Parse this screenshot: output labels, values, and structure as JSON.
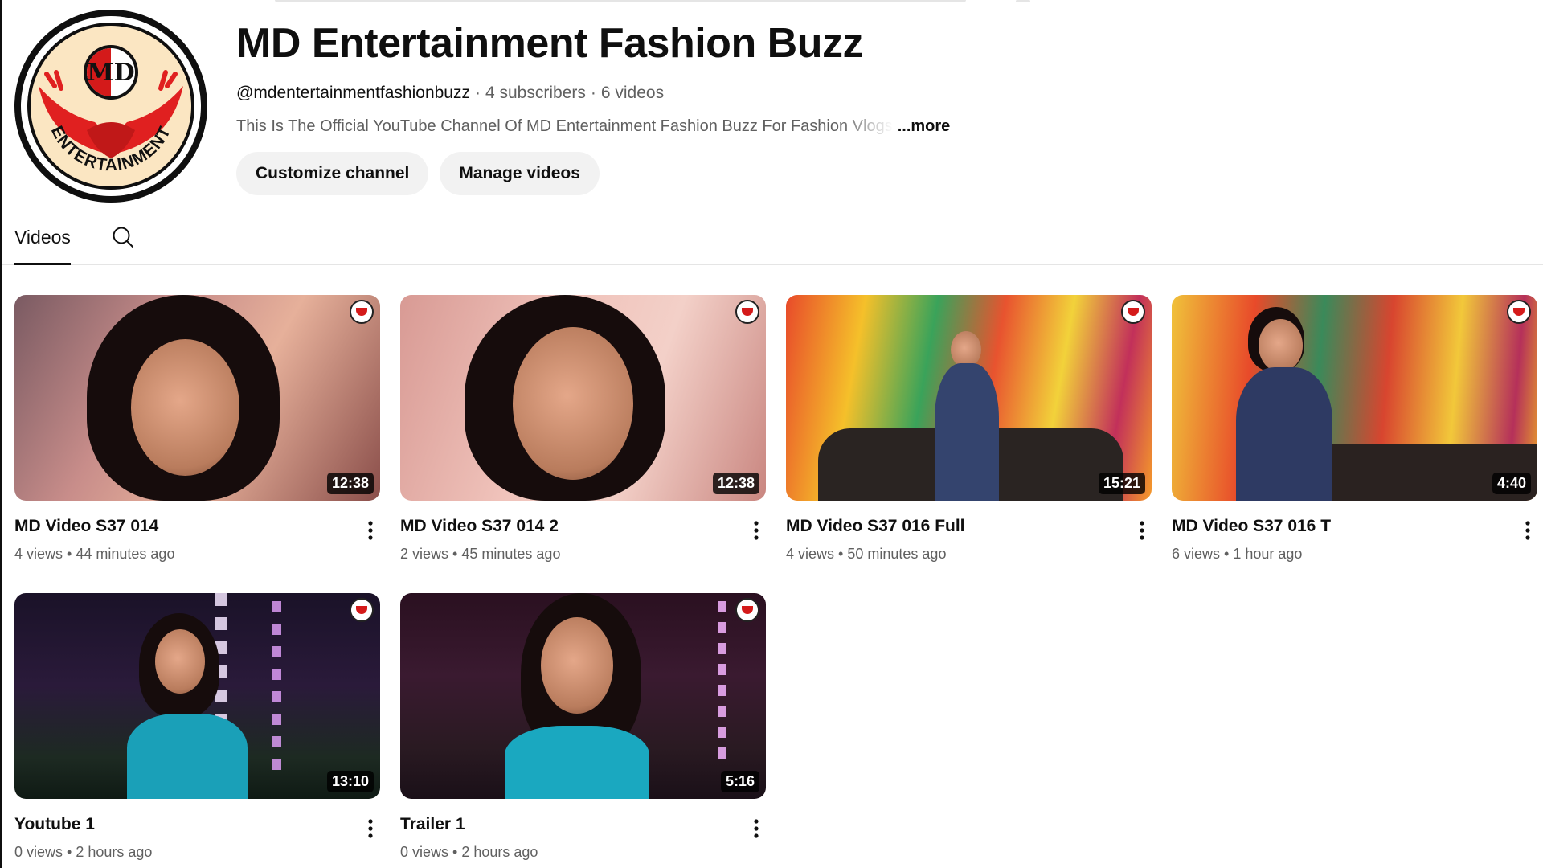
{
  "channel": {
    "name": "MD Entertainment Fashion Buzz",
    "handle": "@mdentertainmentfashionbuzz",
    "subscribers": "4 subscribers",
    "videos_count": "6 videos",
    "separator": "·",
    "description": "This Is The Official YouTube Channel Of MD Entertainment Fashion Buzz For Fashion Vlogs",
    "more_label": "...more",
    "avatar_logo_text": "MD",
    "avatar_ring_text": "ENTERTAINMENT"
  },
  "buttons": {
    "customize": "Customize channel",
    "manage": "Manage videos"
  },
  "tabs": [
    {
      "label": "Videos",
      "active": true
    }
  ],
  "videos": [
    {
      "title": "MD Video S37 014",
      "views": "4 views",
      "time": "44 minutes ago",
      "duration": "12:38",
      "theme": "closeup-warm"
    },
    {
      "title": "MD Video S37 014 2",
      "views": "2 views",
      "time": "45 minutes ago",
      "duration": "12:38",
      "theme": "closeup-pink"
    },
    {
      "title": "MD Video S37 016 Full",
      "views": "4 views",
      "time": "50 minutes ago",
      "duration": "15:21",
      "theme": "graffiti-bike"
    },
    {
      "title": "MD Video S37 016 T",
      "views": "6 views",
      "time": "1 hour ago",
      "duration": "4:40",
      "theme": "graffiti-side"
    },
    {
      "title": "Youtube 1",
      "views": "0 views",
      "time": "2 hours ago",
      "duration": "13:10",
      "theme": "night-lights"
    },
    {
      "title": "Trailer 1",
      "views": "0 views",
      "time": "2 hours ago",
      "duration": "5:16",
      "theme": "night-portrait"
    }
  ],
  "meta_separator": "•",
  "colors": {
    "text_primary": "#0f0f0f",
    "text_secondary": "#606060",
    "pill_bg": "#f2f2f2",
    "logo_red": "#e02020"
  }
}
